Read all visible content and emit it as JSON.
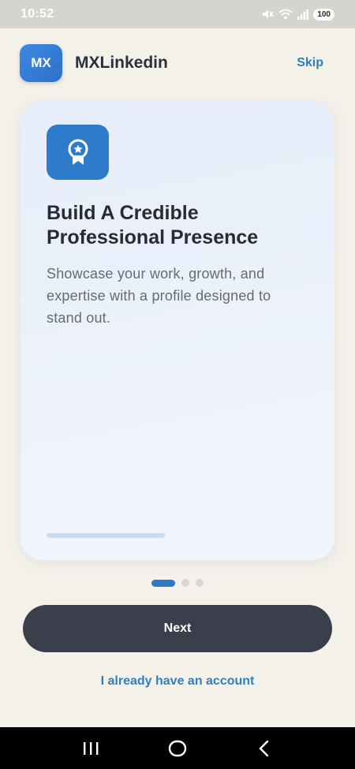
{
  "status_bar": {
    "time": "10:52",
    "battery": "100",
    "icons": [
      "mute-icon",
      "wifi-icon",
      "signal-icon",
      "battery-icon"
    ]
  },
  "header": {
    "logo_text": "MX",
    "app_name": "MXLinkedin",
    "skip_label": "Skip"
  },
  "card": {
    "icon": "award-badge-icon",
    "title": "Build A Credible Professional Presence",
    "description": "Showcase your work, growth, and expertise with a profile designed to stand out."
  },
  "pager": {
    "count": 3,
    "active_index": 0
  },
  "actions": {
    "next_label": "Next",
    "have_account_label": "I already have an account"
  },
  "nav_bar": {
    "icons": [
      "recent-apps-icon",
      "home-icon",
      "back-icon"
    ]
  },
  "colors": {
    "accent": "#2d7fc0",
    "background": "#f4f1e9",
    "button": "#3b3f4b",
    "icon_bg": "#2e7bc9"
  }
}
